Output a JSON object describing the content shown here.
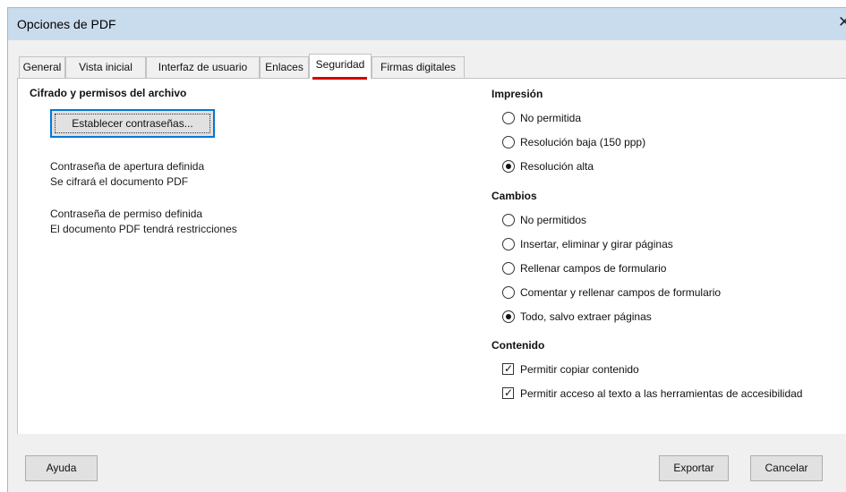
{
  "window": {
    "title": "Opciones de PDF",
    "close_glyph": "✕"
  },
  "tabs": [
    {
      "label": "General"
    },
    {
      "label": "Vista inicial"
    },
    {
      "label": "Interfaz de usuario"
    },
    {
      "label": "Enlaces"
    },
    {
      "label": "Seguridad",
      "active": true
    },
    {
      "label": "Firmas digitales"
    }
  ],
  "left": {
    "heading": "Cifrado y permisos del archivo",
    "set_passwords_button": "Establecer contraseñas...",
    "open_password_status": "Contraseña de apertura definida",
    "encrypt_status": "Se cifrará el documento PDF",
    "permission_password_status": "Contraseña de permiso definida",
    "restrictions_status": "El documento PDF tendrá restricciones"
  },
  "printing": {
    "heading": "Impresión",
    "options": [
      {
        "label": "No permitida",
        "checked": false
      },
      {
        "label": "Resolución baja (150 ppp)",
        "checked": false
      },
      {
        "label": "Resolución alta",
        "checked": true
      }
    ]
  },
  "changes": {
    "heading": "Cambios",
    "options": [
      {
        "label": "No permitidos",
        "checked": false
      },
      {
        "label": "Insertar, eliminar y girar páginas",
        "checked": false
      },
      {
        "label": "Rellenar campos de formulario",
        "checked": false
      },
      {
        "label": "Comentar y rellenar campos de formulario",
        "checked": false
      },
      {
        "label": "Todo, salvo extraer páginas",
        "checked": true
      }
    ]
  },
  "content": {
    "heading": "Contenido",
    "options": [
      {
        "label": "Permitir copiar contenido",
        "checked": true
      },
      {
        "label": "Permitir acceso al texto a las herramientas de accesibilidad",
        "checked": true
      }
    ]
  },
  "footer": {
    "help": "Ayuda",
    "export": "Exportar",
    "cancel": "Cancelar"
  },
  "colors": {
    "titlebar": "#c9dced",
    "dialog_bg": "#f0f0f0",
    "focus_border": "#0078d7",
    "tab_underline": "#d40000"
  }
}
